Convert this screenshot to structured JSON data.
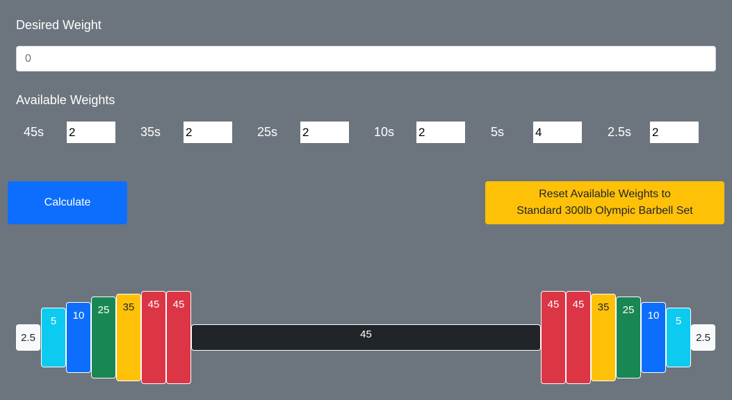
{
  "desired": {
    "label": "Desired Weight",
    "placeholder": "0",
    "value": ""
  },
  "available": {
    "label": "Available Weights",
    "items": [
      {
        "label": "45s",
        "count": "2"
      },
      {
        "label": "35s",
        "count": "2"
      },
      {
        "label": "25s",
        "count": "2"
      },
      {
        "label": "10s",
        "count": "2"
      },
      {
        "label": "5s",
        "count": "4"
      },
      {
        "label": "2.5s",
        "count": "2"
      }
    ]
  },
  "buttons": {
    "calculate": "Calculate",
    "reset_line1": "Reset Available Weights to",
    "reset_line2": "Standard 300lb Olympic Barbell Set"
  },
  "barbell": {
    "bar_label": "45",
    "left_plates": [
      "2.5",
      "5",
      "10",
      "25",
      "35",
      "45",
      "45"
    ],
    "right_plates": [
      "45",
      "45",
      "35",
      "25",
      "10",
      "5",
      "2.5"
    ]
  },
  "colors": {
    "background": "#6c757d",
    "plate_45": "#dc3545",
    "plate_35": "#ffc107",
    "plate_25": "#198754",
    "plate_10": "#0d6efd",
    "plate_5": "#0dcaf0",
    "plate_2_5": "#f8f9fa",
    "bar": "#212529"
  }
}
